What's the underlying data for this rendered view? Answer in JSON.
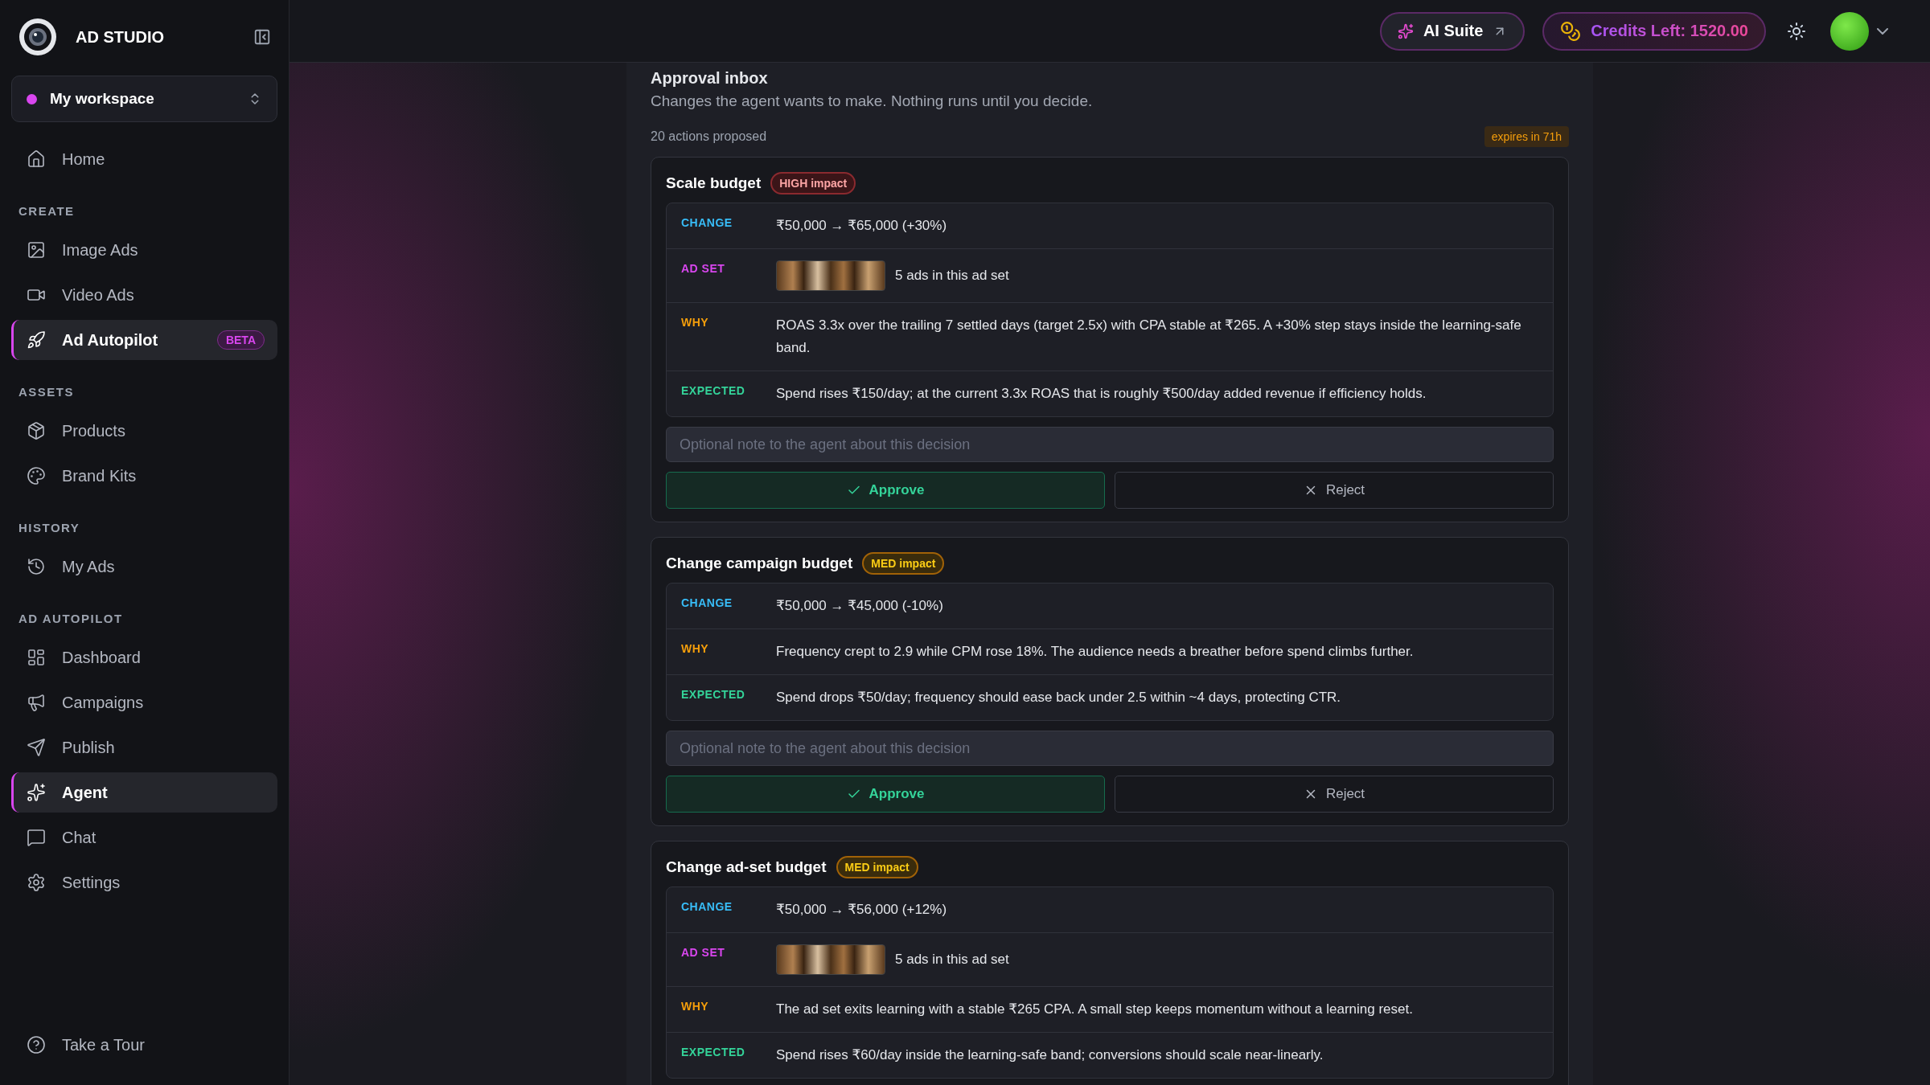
{
  "sidebar": {
    "brand": "AD STUDIO",
    "workspace": {
      "name": "My workspace",
      "color": "#d946ef"
    },
    "sections": [
      {
        "items": [
          {
            "label": "Home",
            "selected": false
          }
        ]
      },
      {
        "title": "CREATE",
        "items": [
          {
            "label": "Image Ads",
            "selected": false
          },
          {
            "label": "Video Ads",
            "selected": false
          },
          {
            "label": "Ad Autopilot",
            "selected": true,
            "badge": "BETA"
          }
        ]
      },
      {
        "title": "ASSETS",
        "items": [
          {
            "label": "Products",
            "selected": false
          },
          {
            "label": "Brand Kits",
            "selected": false
          }
        ]
      },
      {
        "title": "HISTORY",
        "items": [
          {
            "label": "My Ads",
            "selected": false
          }
        ]
      },
      {
        "title": "AD AUTOPILOT",
        "items": [
          {
            "label": "Dashboard",
            "selected": false
          },
          {
            "label": "Campaigns",
            "selected": false
          },
          {
            "label": "Publish",
            "selected": false
          },
          {
            "label": "Agent",
            "selected": true
          },
          {
            "label": "Chat",
            "selected": false
          },
          {
            "label": "Settings",
            "selected": false
          }
        ]
      }
    ],
    "footer": "Take a Tour"
  },
  "topbar": {
    "ai_suite": "AI Suite",
    "credits": "Credits Left: 1520.00"
  },
  "inbox": {
    "title": "Approval inbox",
    "subtitle": "Changes the agent wants to make. Nothing runs until you decide.",
    "count": "20 actions proposed",
    "expires": "expires in 71h",
    "cards": [
      {
        "title": "Scale budget",
        "kind": "high",
        "impact_label": "HIGH impact",
        "rows": [
          {
            "kind": "change",
            "label": "CHANGE",
            "text": "₹50,000 → ₹65,000 (+30%)"
          },
          {
            "kind": "adset",
            "label": "AD SET",
            "text": "5 ads in this ad set"
          },
          {
            "kind": "why",
            "label": "WHY",
            "text": "ROAS 3.3x over the trailing 7 settled days (target 2.5x) with CPA stable at ₹265. A +30% step stays inside the learning-safe band."
          },
          {
            "kind": "expected",
            "label": "EXPECTED",
            "text": "Spend rises ₹150/day; at the current 3.3x ROAS that is roughly ₹500/day added revenue if efficiency holds."
          }
        ],
        "note_placeholder": "Optional note to the agent about this decision",
        "approve": "Approve",
        "reject": "Reject"
      },
      {
        "title": "Change campaign budget",
        "kind": "med",
        "impact_label": "MED impact",
        "rows": [
          {
            "kind": "change",
            "label": "CHANGE",
            "text": "₹50,000 → ₹45,000 (-10%)"
          },
          {
            "kind": "why",
            "label": "WHY",
            "text": "Frequency crept to 2.9 while CPM rose 18%. The audience needs a breather before spend climbs further."
          },
          {
            "kind": "expected",
            "label": "EXPECTED",
            "text": "Spend drops ₹50/day; frequency should ease back under 2.5 within ~4 days, protecting CTR."
          }
        ],
        "note_placeholder": "Optional note to the agent about this decision",
        "approve": "Approve",
        "reject": "Reject"
      },
      {
        "title": "Change ad-set budget",
        "kind": "med",
        "impact_label": "MED impact",
        "rows": [
          {
            "kind": "change",
            "label": "CHANGE",
            "text": "₹50,000 → ₹56,000 (+12%)"
          },
          {
            "kind": "adset",
            "label": "AD SET",
            "text": "5 ads in this ad set"
          },
          {
            "kind": "why",
            "label": "WHY",
            "text": "The ad set exits learning with a stable ₹265 CPA. A small step keeps momentum without a learning reset."
          },
          {
            "kind": "expected",
            "label": "EXPECTED",
            "text": "Spend rises ₹60/day inside the learning-safe band; conversions should scale near-linearly."
          }
        ]
      }
    ]
  }
}
